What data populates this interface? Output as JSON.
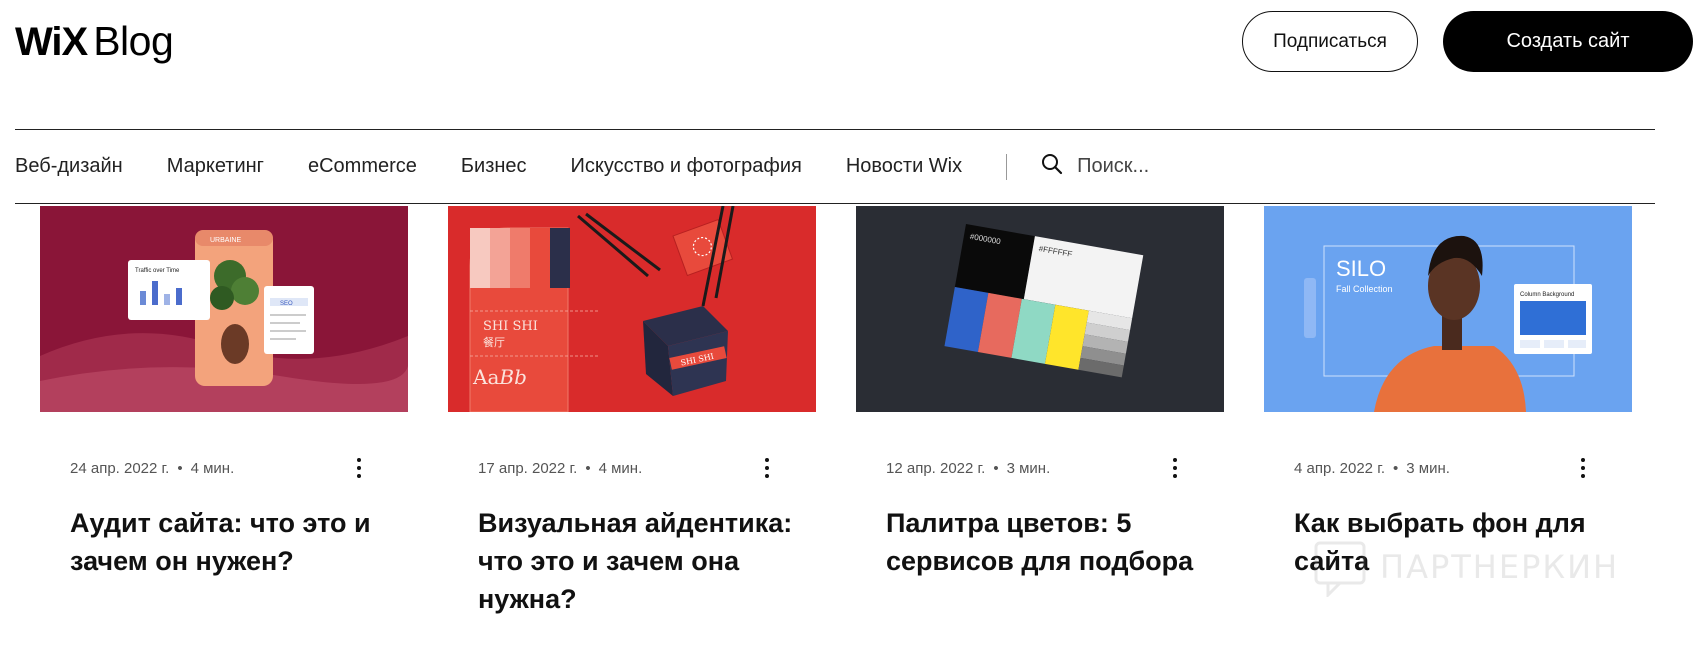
{
  "header": {
    "logo_mark": "WiX",
    "logo_text": "Blog",
    "subscribe_label": "Подписаться",
    "create_label": "Создать сайт"
  },
  "nav": {
    "items": [
      "Веб-дизайн",
      "Маркетинг",
      "eCommerce",
      "Бизнес",
      "Искусство и фотография",
      "Новости Wix"
    ],
    "search_placeholder": "Поиск...",
    "search_icon": "search-icon"
  },
  "posts": [
    {
      "date": "24 апр. 2022 г.",
      "sep": "•",
      "read_time": "4 мин.",
      "title": "Аудит сайта: что это и зачем он нужен?",
      "image_text": {
        "brand": "URBAINE",
        "card_label": "Traffic over Time",
        "tag": "SEO"
      }
    },
    {
      "date": "17 апр. 2022 г.",
      "sep": "•",
      "read_time": "4 мин.",
      "title": "Визуальная айдентика: что это и зачем она нужна?",
      "image_text": {
        "brand": "SHI SHI",
        "hanzi": "餐厅",
        "sample": "Aa",
        "sample_italic": "Bb"
      }
    },
    {
      "date": "12 апр. 2022 г.",
      "sep": "•",
      "read_time": "3 мин.",
      "title": "Палитра цветов: 5 сервисов для подбора",
      "image_text": {
        "black_hex": "#000000",
        "white_hex": "#FFFFFF"
      }
    },
    {
      "date": "4 апр. 2022 г.",
      "sep": "•",
      "read_time": "3 мин.",
      "title": "Как выбрать фон для сайта",
      "image_text": {
        "brand": "SILO",
        "subtitle": "Fall Collection",
        "panel_title": "Column Background"
      }
    }
  ],
  "watermark": "ПАРТНЕРКИН",
  "colors": {
    "primary": "#000000",
    "background": "#ffffff",
    "muted_text": "#555555"
  }
}
